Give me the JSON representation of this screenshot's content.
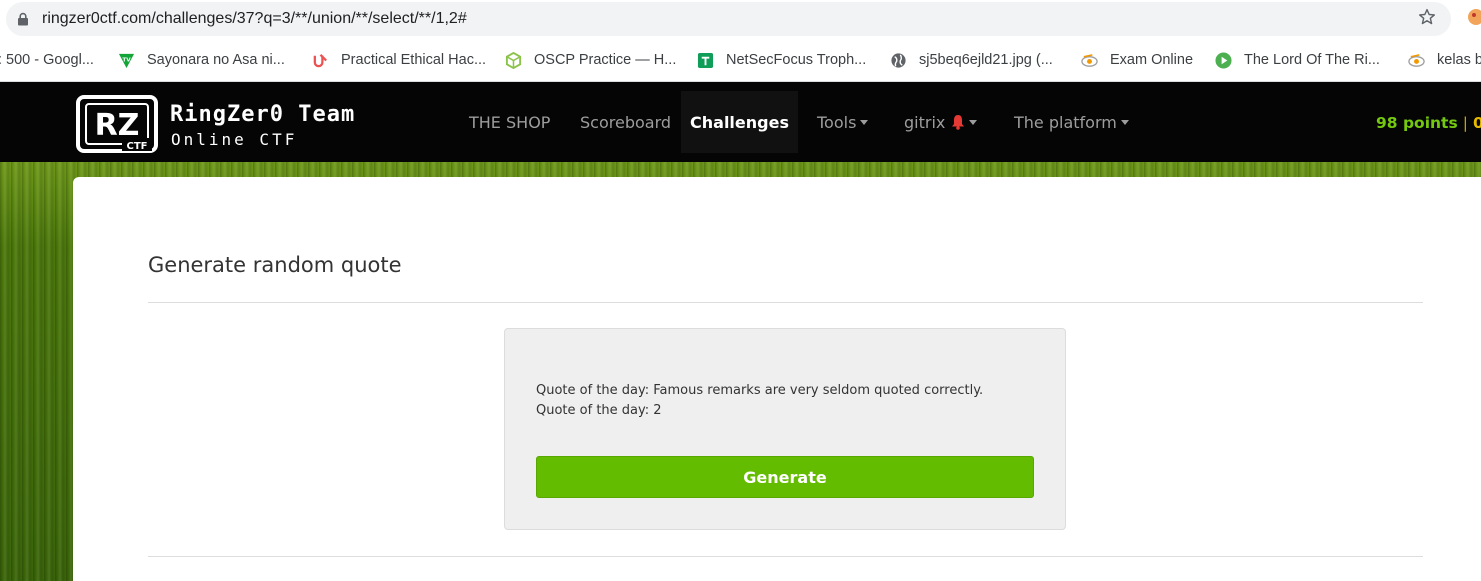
{
  "browser": {
    "url": "ringzer0ctf.com/challenges/37?q=3/**/union/**/select/**/1,2#",
    "lock_icon": "lock-icon",
    "star_icon": "star-icon",
    "bookmarks": [
      {
        "label": ": 500 - Googl...",
        "icon": "none"
      },
      {
        "label": "Sayonara no Asa ni...",
        "icon": "tv-icon",
        "color": "#13a538"
      },
      {
        "label": "Practical Ethical Hac...",
        "icon": "udemy-icon",
        "color": "#ec5252"
      },
      {
        "label": "OSCP Practice — H...",
        "icon": "hexagon-icon",
        "color": "#8bc34a"
      },
      {
        "label": "NetSecFocus Troph...",
        "icon": "sheets-icon",
        "color": "#0f9d58"
      },
      {
        "label": "sj5beq6ejld21.jpg (...",
        "icon": "globe-icon",
        "color": "#5f6368"
      },
      {
        "label": "Exam Online",
        "icon": "eye-icon",
        "color": "#f29900"
      },
      {
        "label": "The Lord Of The Ri...",
        "icon": "play-icon",
        "color": "#4caf50"
      },
      {
        "label": "kelas b",
        "icon": "eye-icon",
        "color": "#f29900"
      }
    ]
  },
  "navbar": {
    "logo_text_1": "RingZer0 Team",
    "logo_text_2": "Online CTF",
    "logo_badge": "RZ",
    "logo_badge_sub": "CTF",
    "items": [
      {
        "label": "THE SHOP",
        "dropdown": false,
        "active": false
      },
      {
        "label": "Scoreboard",
        "dropdown": false,
        "active": false
      },
      {
        "label": "Challenges",
        "dropdown": false,
        "active": true
      },
      {
        "label": "Tools",
        "dropdown": true,
        "active": false
      },
      {
        "label": "gitrix",
        "dropdown": true,
        "active": false,
        "icon": "bell-icon"
      },
      {
        "label": "The platform",
        "dropdown": true,
        "active": false
      }
    ],
    "points": "98 points",
    "separator": "|",
    "extra": "0"
  },
  "main": {
    "title": "Generate random quote",
    "quotes": [
      "Quote of the day: Famous remarks are very seldom quoted correctly.",
      "Quote of the day: 2"
    ],
    "button_label": "Generate"
  },
  "colors": {
    "accent_green": "#64bc00",
    "points_green": "#74c90e",
    "navbar_bg": "#050505",
    "bell_red": "#e53935"
  }
}
